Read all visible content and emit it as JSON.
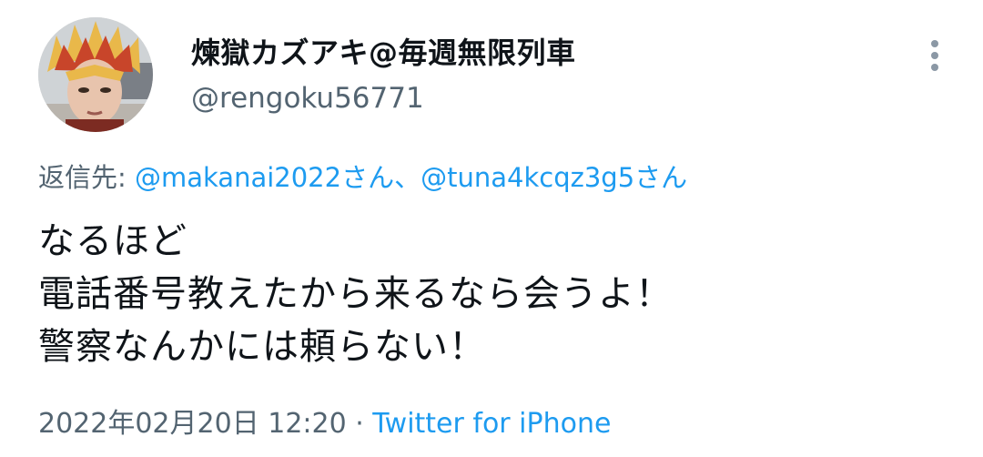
{
  "user": {
    "display_name": "煉獄カズアキ@毎週無限列車",
    "handle": "@rengoku56771"
  },
  "reply": {
    "prefix": "返信先: ",
    "mention_1": "@makanai2022さん",
    "separator": "、",
    "mention_2": "@tuna4kcqz3g5さん"
  },
  "body": {
    "lines": [
      "なるほど",
      "電話番号教えたから来るなら会うよ！",
      "警察なんかには頼らない！"
    ]
  },
  "meta": {
    "timestamp": "2022年02月20日 12:20",
    "dot": " · ",
    "source": "Twitter for iPhone"
  },
  "icons": {
    "more": "more-vertical-icon"
  },
  "colors": {
    "text": "#0f1419",
    "secondary": "#536471",
    "link": "#1d9bf0"
  }
}
